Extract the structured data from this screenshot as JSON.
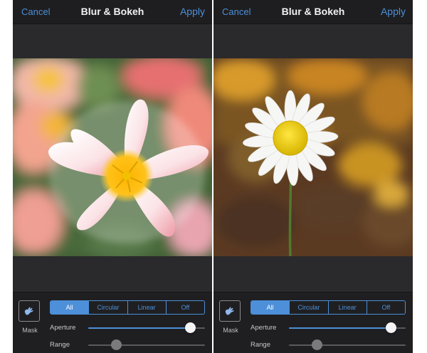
{
  "colors": {
    "accent": "#4d8fd9",
    "navbar": "#1e1e20",
    "canvas": "#2a2a2c",
    "toolbar": "#1f1f21"
  },
  "screens": [
    {
      "nav": {
        "cancel": "Cancel",
        "title": "Blur & Bokeh",
        "apply": "Apply"
      },
      "photo": "pink-lily-flower",
      "mask": {
        "label": "Mask",
        "icon": "hand-brush-icon"
      },
      "modes": [
        "All",
        "Circular",
        "Linear",
        "Off"
      ],
      "selected_mode": "All",
      "aperture": {
        "label": "Aperture",
        "level": 0.87
      },
      "range": {
        "label": "Range",
        "level": 0.24
      }
    },
    {
      "nav": {
        "cancel": "Cancel",
        "title": "Blur & Bokeh",
        "apply": "Apply"
      },
      "photo": "white-daisy",
      "mask": {
        "label": "Mask",
        "icon": "hand-brush-icon"
      },
      "modes": [
        "All",
        "Circular",
        "Linear",
        "Off"
      ],
      "selected_mode": "All",
      "aperture": {
        "label": "Aperture",
        "level": 0.87
      },
      "range": {
        "label": "Range",
        "level": 0.24
      }
    }
  ]
}
